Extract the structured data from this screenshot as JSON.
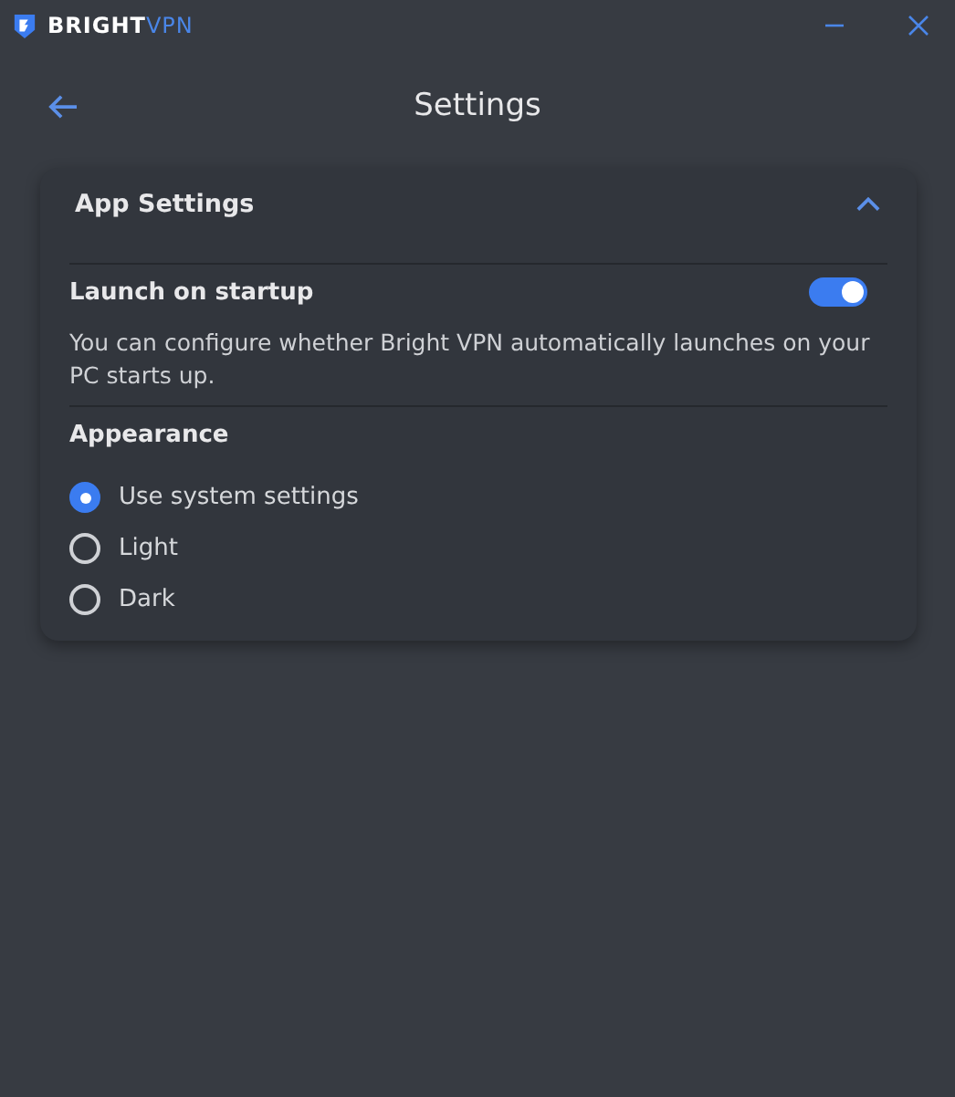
{
  "titlebar": {
    "brand": "BRIGHT",
    "brand_accent": "VPN"
  },
  "header": {
    "title": "Settings"
  },
  "section": {
    "title": "App Settings",
    "expanded": true,
    "launch": {
      "label": "Launch on startup",
      "on": true,
      "description": "You can configure whether Bright VPN automatically launches on your PC starts up."
    },
    "appearance": {
      "label": "Appearance",
      "options": [
        {
          "label": "Use system settings",
          "selected": true
        },
        {
          "label": "Light",
          "selected": false
        },
        {
          "label": "Dark",
          "selected": false
        }
      ]
    }
  }
}
